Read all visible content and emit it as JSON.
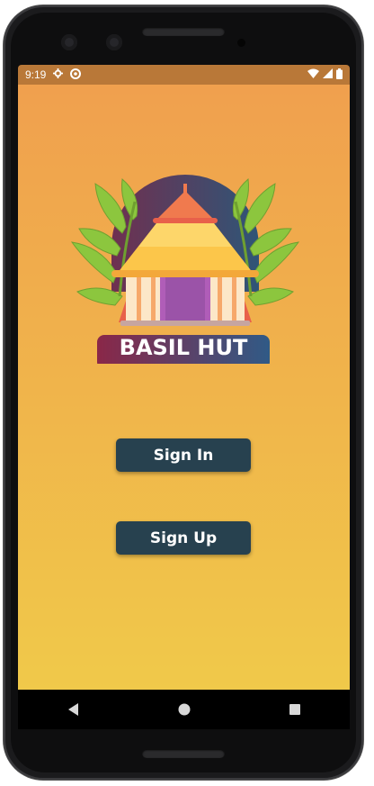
{
  "status_bar": {
    "time": "9:19",
    "icons": [
      "gear-icon",
      "sync-icon",
      "wifi-icon",
      "signal-icon",
      "battery-icon"
    ]
  },
  "app": {
    "logo_text": "BASIL HUT",
    "sign_in_label": "Sign In",
    "sign_up_label": "Sign Up"
  },
  "nav_bar": {
    "buttons": [
      "back-icon",
      "home-icon",
      "recents-icon"
    ]
  },
  "colors": {
    "gradient_top": "#f0a04e",
    "gradient_bottom": "#f0c94a",
    "button": "#27414f",
    "status_bar": "#b97838"
  }
}
